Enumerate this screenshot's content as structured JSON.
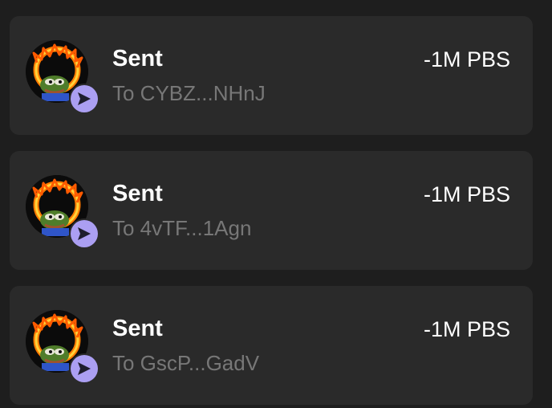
{
  "colors": {
    "background": "#1e1e1e",
    "card": "#2a2a2a",
    "title": "#ffffff",
    "subtitle": "#777777",
    "badge": "#ab9ff2"
  },
  "transactions": [
    {
      "title": "Sent",
      "subtitle": "To CYBZ...NHnJ",
      "amount": "-1M PBS",
      "token_icon": "pepe-fire-ring-icon",
      "badge_icon": "send-arrow-icon"
    },
    {
      "title": "Sent",
      "subtitle": "To 4vTF...1Agn",
      "amount": "-1M PBS",
      "token_icon": "pepe-fire-ring-icon",
      "badge_icon": "send-arrow-icon"
    },
    {
      "title": "Sent",
      "subtitle": "To GscP...GadV",
      "amount": "-1M PBS",
      "token_icon": "pepe-fire-ring-icon",
      "badge_icon": "send-arrow-icon"
    }
  ]
}
